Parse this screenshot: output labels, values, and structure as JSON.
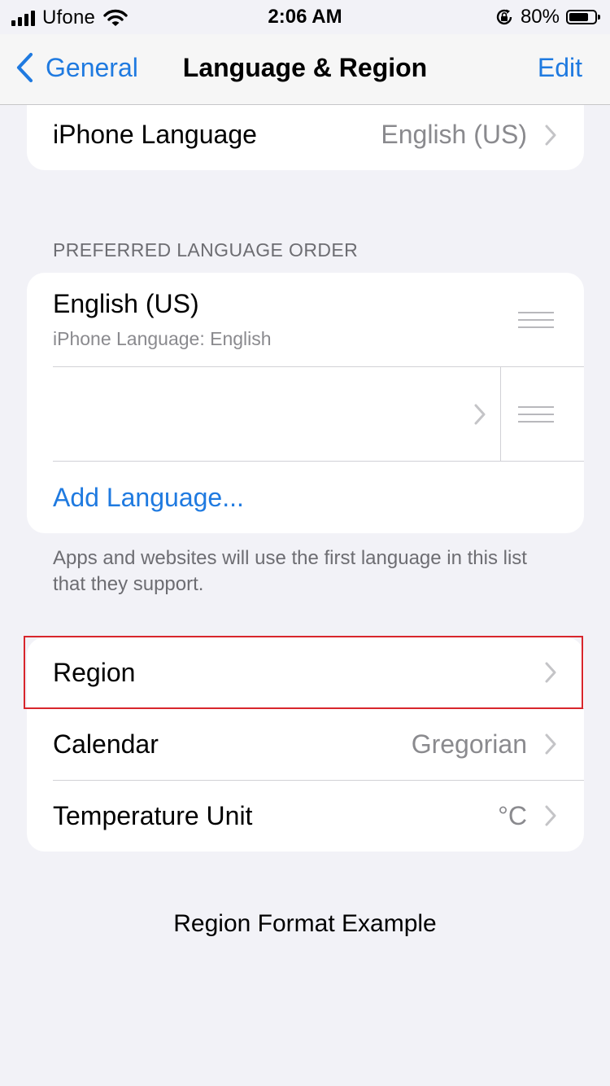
{
  "status_bar": {
    "carrier": "Ufone",
    "time": "2:06 AM",
    "battery_percent": "80%",
    "battery_level": 0.8
  },
  "nav": {
    "back_label": "General",
    "title": "Language & Region",
    "edit_label": "Edit"
  },
  "iphone_language": {
    "label": "iPhone Language",
    "value": "English (US)"
  },
  "preferred": {
    "header": "PREFERRED LANGUAGE ORDER",
    "languages": [
      {
        "name": "English (US)",
        "subtitle": "iPhone Language: English"
      },
      {
        "name": "",
        "subtitle": ""
      }
    ],
    "add_language": "Add Language...",
    "footer": "Apps and websites will use the first language in this list that they support."
  },
  "region_settings": {
    "region_label": "Region",
    "calendar_label": "Calendar",
    "calendar_value": "Gregorian",
    "temperature_label": "Temperature Unit",
    "temperature_value": "°C"
  },
  "format_example": "Region Format Example",
  "colors": {
    "accent": "#1f7ae0",
    "background": "#f2f2f7",
    "highlight": "#d8262c"
  }
}
